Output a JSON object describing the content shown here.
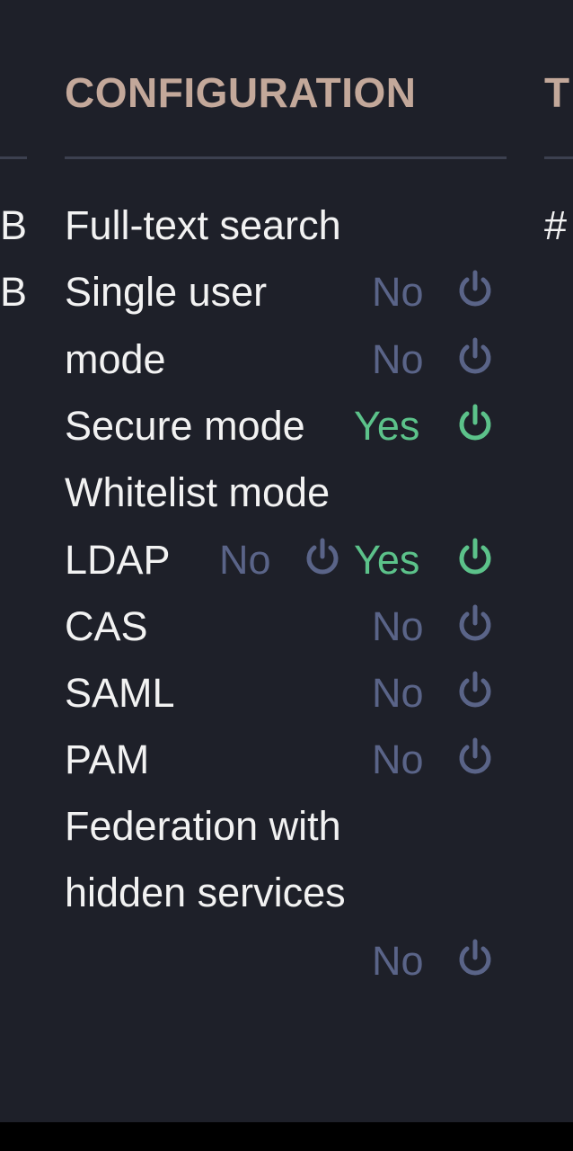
{
  "left_column": {
    "edge_glyphs": [
      "B",
      "B"
    ]
  },
  "config": {
    "title": "CONFIGURATION",
    "items": [
      {
        "label": "Full-text search"
      },
      {
        "label": "Single user",
        "status": "No"
      },
      {
        "label": "mode",
        "status": "No"
      },
      {
        "label": "Secure mode",
        "status": "Yes"
      },
      {
        "label": "Whitelist mode"
      },
      {
        "label": "LDAP",
        "status_a": "No",
        "status_b": "Yes"
      },
      {
        "label": "CAS",
        "status": "No"
      },
      {
        "label": "SAML",
        "status": "No"
      },
      {
        "label": "PAM",
        "status": "No"
      },
      {
        "label": "Federation with"
      },
      {
        "label": "hidden services"
      },
      {
        "status": "No"
      }
    ]
  },
  "right_column": {
    "title_partial": "T",
    "edge_glyph": "#"
  },
  "icons": {
    "toggle": "power-icon"
  },
  "colors": {
    "background": "#1e2029",
    "title": "#c3a89a",
    "no": "#5a6488",
    "yes": "#5cc28a",
    "text": "#f2f2f2",
    "rule": "#3c404f"
  }
}
